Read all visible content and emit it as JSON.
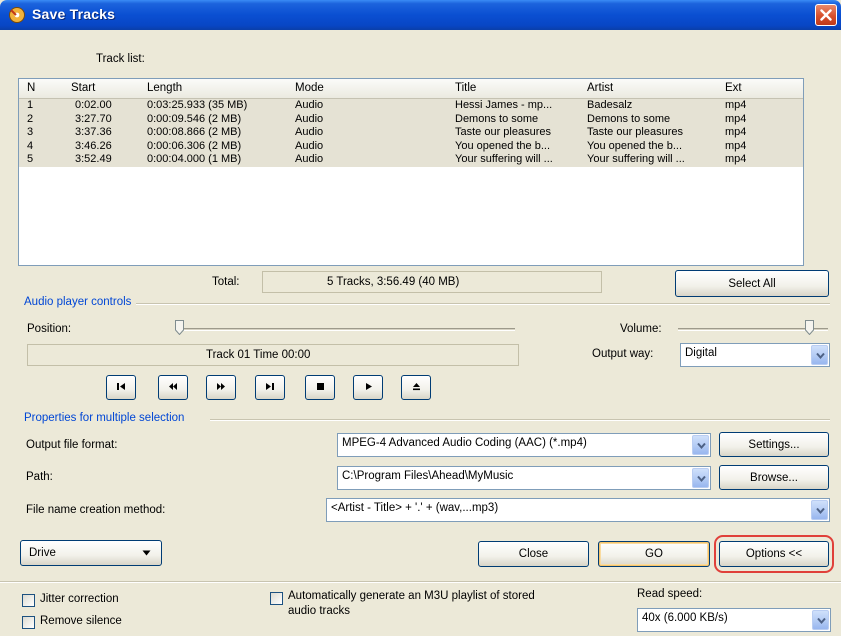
{
  "window": {
    "title": "Save Tracks"
  },
  "track_list": {
    "label": "Track list:",
    "columns": [
      "N",
      "Start",
      "Length",
      "Mode",
      "Title",
      "Artist",
      "Ext"
    ],
    "rows": [
      [
        "1",
        "0:02.00",
        "0:03:25.933 (35 MB)",
        "Audio",
        "Hessi James - mp...",
        "Badesalz",
        "mp4"
      ],
      [
        "2",
        "3:27.70",
        "0:00:09.546 (2 MB)",
        "Audio",
        "Demons to some",
        "Demons to some",
        "mp4"
      ],
      [
        "3",
        "3:37.36",
        "0:00:08.866 (2 MB)",
        "Audio",
        "Taste our pleasures",
        "Taste our pleasures",
        "mp4"
      ],
      [
        "4",
        "3:46.26",
        "0:00:06.306 (2 MB)",
        "Audio",
        "You opened the b...",
        "You opened the b...",
        "mp4"
      ],
      [
        "5",
        "3:52.49",
        "0:00:04.000 (1 MB)",
        "Audio",
        "Your suffering will ...",
        "Your suffering will ...",
        "mp4"
      ]
    ]
  },
  "total": {
    "label": "Total:",
    "value": "5 Tracks,  3:56.49 (40 MB)"
  },
  "select_all_label": "Select All",
  "player": {
    "group_label": "Audio player controls",
    "position_label": "Position:",
    "position_fraction": 0,
    "volume_label": "Volume:",
    "volume_fraction": 0.9,
    "status": "Track 01 Time 00:00",
    "output_way_label": "Output way:",
    "output_way_value": "Digital"
  },
  "props": {
    "group_label": "Properties for multiple selection",
    "output_format_label": "Output file format:",
    "output_format_value": "MPEG-4 Advanced Audio Coding (AAC) (*.mp4)",
    "settings_label": "Settings...",
    "path_label": "Path:",
    "path_value": "C:\\Program Files\\Ahead\\MyMusic",
    "browse_label": "Browse...",
    "filename_label": "File name creation method:",
    "filename_value": "<Artist - Title> + '.' + (wav,...mp3)"
  },
  "footer": {
    "drive_label": "Drive",
    "close_label": "Close",
    "go_label": "GO",
    "options_label": "Options <<",
    "jitter_label": "Jitter correction",
    "remove_silence_label": "Remove silence",
    "m3u_label_line1": "Automatically generate an M3U playlist of stored",
    "m3u_label_line2": "audio tracks",
    "read_speed_label": "Read speed:",
    "read_speed_value": "40x (6.000 KB/s)"
  },
  "colors": {
    "titlebar": "#0a4fd2",
    "group_title": "#0046d5",
    "highlight": "#e0403a"
  }
}
